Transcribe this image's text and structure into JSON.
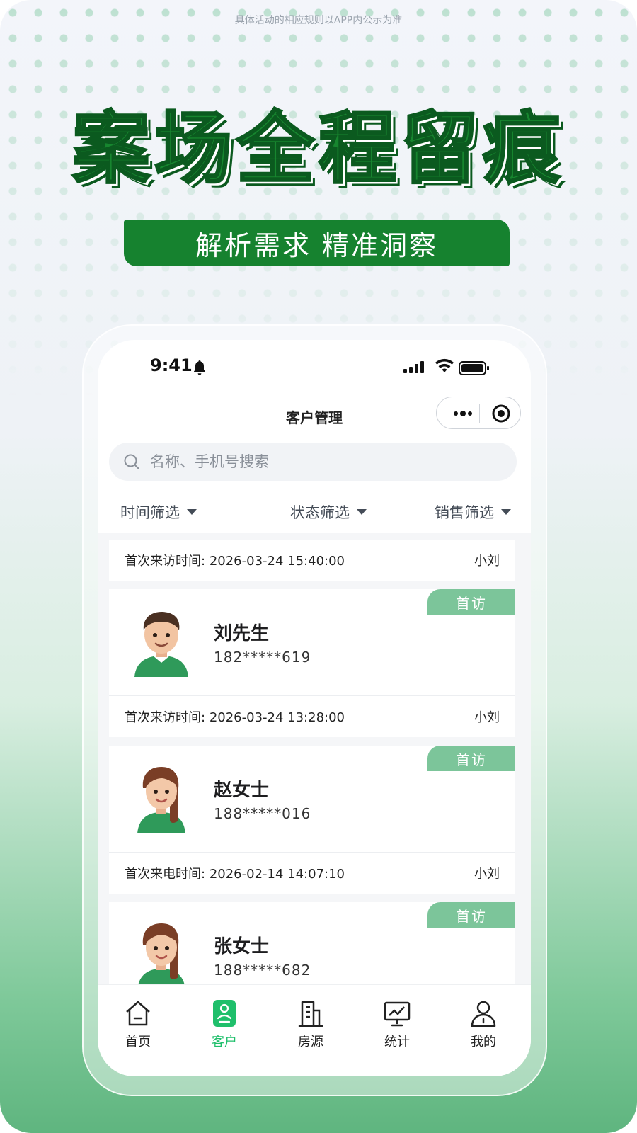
{
  "poster": {
    "disclaimer": "具体活动的相应规则以APP内公示为准",
    "headline": "案场全程留痕",
    "subheadline": "解析需求 精准洞察"
  },
  "statusbar": {
    "time": "9:41"
  },
  "navbar": {
    "title": "客户管理"
  },
  "search": {
    "placeholder": "名称、手机号搜索"
  },
  "filters": [
    {
      "label": "时间筛选"
    },
    {
      "label": "状态筛选"
    },
    {
      "label": "销售筛选"
    }
  ],
  "visits": [
    {
      "label": "首次来访时间:",
      "time": "2026-03-24 15:40:00",
      "sales": "小刘"
    },
    {
      "label": "首次来访时间:",
      "time": "2026-03-24 13:28:00",
      "sales": "小刘"
    },
    {
      "label": "首次来电时间:",
      "time": "2026-02-14 14:07:10",
      "sales": "小刘"
    }
  ],
  "customers": [
    {
      "name": "刘先生",
      "phone": "182*****619",
      "badge": "首访"
    },
    {
      "name": "赵女士",
      "phone": "188*****016",
      "badge": "首访"
    },
    {
      "name": "张女士",
      "phone": "188*****682",
      "badge": "首访"
    }
  ],
  "tabbar": {
    "items": [
      {
        "label": "首页",
        "icon": "home-icon"
      },
      {
        "label": "客户",
        "icon": "customer-icon",
        "active": true
      },
      {
        "label": "房源",
        "icon": "building-icon"
      },
      {
        "label": "统计",
        "icon": "chart-icon"
      },
      {
        "label": "我的",
        "icon": "profile-icon"
      }
    ]
  },
  "colors": {
    "brand_green": "#17862f",
    "badge_green": "#7cc59a",
    "active_tab": "#1fbf6b"
  }
}
